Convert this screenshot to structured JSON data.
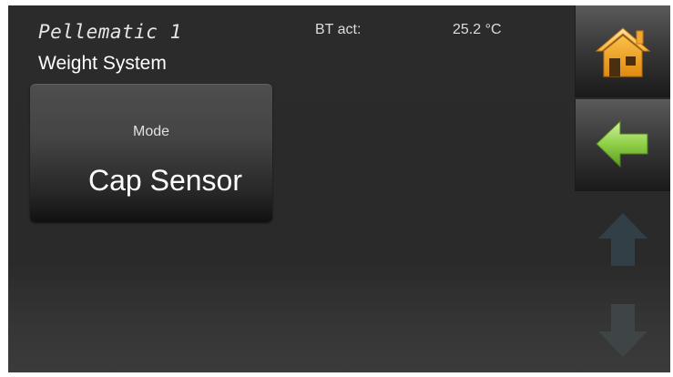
{
  "header": {
    "device_name": "Pellematic 1",
    "page_title": "Weight System",
    "bt_label": "BT act:",
    "bt_value": "25.2 °C"
  },
  "mode_card": {
    "label": "Mode",
    "value": "Cap Sensor"
  },
  "navigation": {
    "icons": [
      "home-icon",
      "back-arrow-icon",
      "up-arrow-icon",
      "down-arrow-icon"
    ],
    "up_enabled": false,
    "down_enabled": false
  },
  "colors": {
    "home_icon": "#f0a020",
    "back_icon": "#7ec23a",
    "text": "#ffffff"
  }
}
